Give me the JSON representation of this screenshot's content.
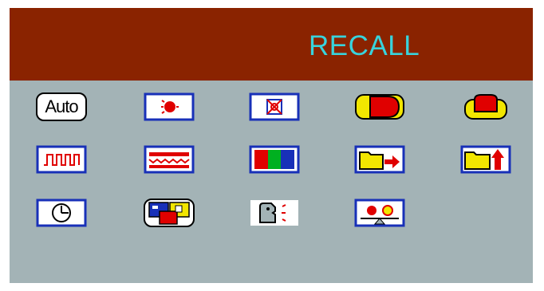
{
  "menu": {
    "title": "RECALL",
    "colors": {
      "header": "#8a2300",
      "panel": "#a3b3b6",
      "title": "#38d3dc",
      "iconFrame": "#1830b8"
    },
    "icons": [
      {
        "name": "auto-adjust-icon",
        "text": "Auto"
      },
      {
        "name": "brightness-icon"
      },
      {
        "name": "contrast-icon"
      },
      {
        "name": "horizontal-position-icon"
      },
      {
        "name": "vertical-position-icon"
      },
      {
        "name": "clock-icon"
      },
      {
        "name": "phase-icon"
      },
      {
        "name": "color-icon"
      },
      {
        "name": "horizontal-size-icon"
      },
      {
        "name": "vertical-size-icon"
      },
      {
        "name": "osd-timer-icon"
      },
      {
        "name": "language-icon"
      },
      {
        "name": "recall-icon"
      },
      {
        "name": "input-select-icon"
      }
    ]
  }
}
